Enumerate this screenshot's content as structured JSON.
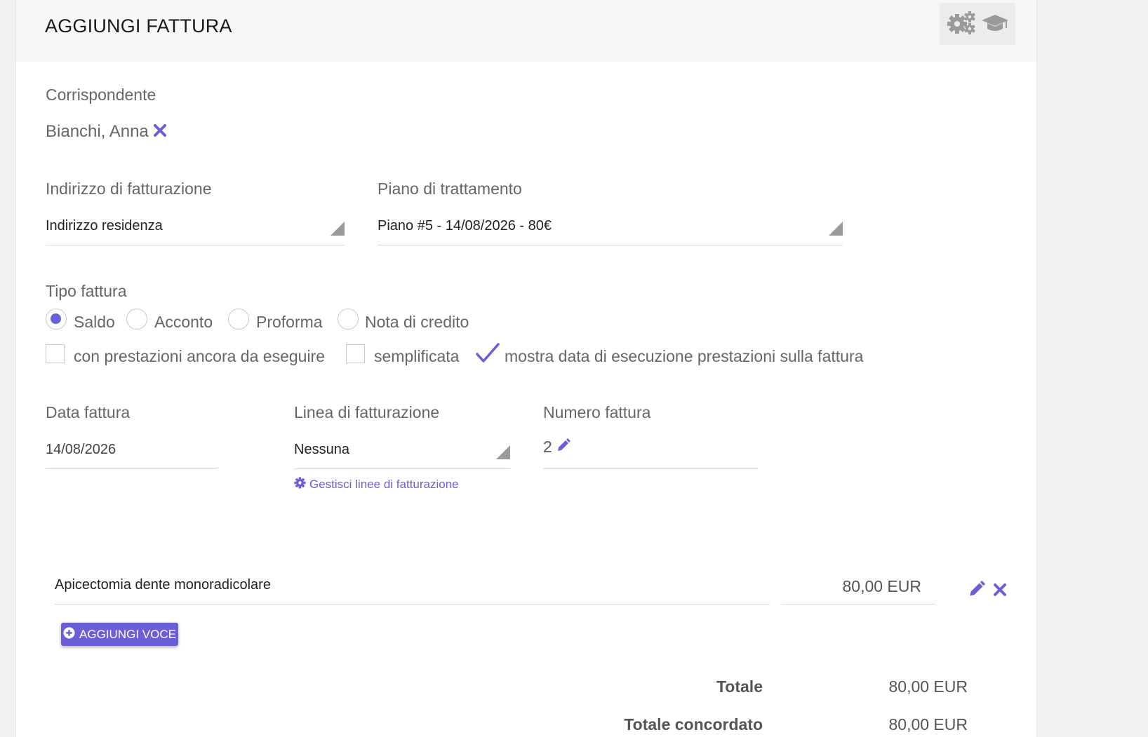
{
  "header": {
    "title": "AGGIUNGI FATTURA",
    "tools": [
      "gears-icon",
      "graduation-cap-icon"
    ]
  },
  "correspondent": {
    "label": "Corrispondente",
    "value": "Bianchi, Anna"
  },
  "billing_address": {
    "label": "Indirizzo di fatturazione",
    "value": "Indirizzo residenza"
  },
  "treatment_plan": {
    "label": "Piano di trattamento",
    "value": "Piano #5 - 14/08/2026 - 80€"
  },
  "invoice_type": {
    "label": "Tipo fattura",
    "options": [
      {
        "label": "Saldo",
        "checked": true
      },
      {
        "label": "Acconto",
        "checked": false
      },
      {
        "label": "Proforma",
        "checked": false
      },
      {
        "label": "Nota di credito",
        "checked": false
      }
    ],
    "flags": [
      {
        "label": "con prestazioni ancora da eseguire",
        "checked": false
      },
      {
        "label": "semplificata",
        "checked": false
      },
      {
        "label": "mostra data di esecuzione prestazioni sulla fattura",
        "checked": true
      }
    ]
  },
  "invoice_date": {
    "label": "Data fattura",
    "value": "14/08/2026"
  },
  "billing_line": {
    "label": "Linea di fatturazione",
    "value": "Nessuna",
    "manage_link": "Gestisci linee di fatturazione"
  },
  "invoice_number": {
    "label": "Numero fattura",
    "value": "2"
  },
  "items": [
    {
      "description": "Apicectomia dente monoradicolare",
      "amount": "80,00 EUR"
    }
  ],
  "add_item_label": "AGGIUNGI VOCE",
  "totals": {
    "total_label": "Totale",
    "total_value": "80,00 EUR",
    "agreed_label": "Totale concordato",
    "agreed_value": "80,00 EUR"
  },
  "colors": {
    "accent": "#6a5fd8",
    "header_bg": "#f7f7f7"
  }
}
